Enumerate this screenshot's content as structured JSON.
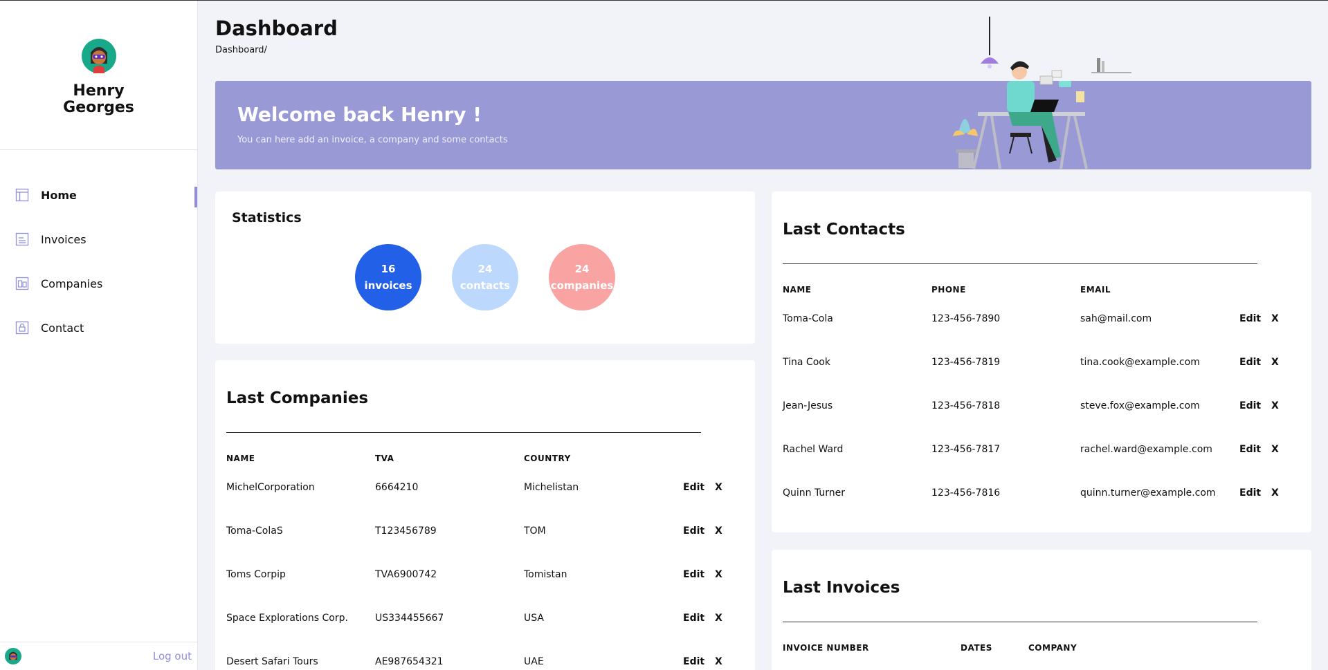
{
  "profile": {
    "name": "Henry Georges"
  },
  "nav": {
    "items": [
      {
        "label": "Home",
        "icon": "layout-icon",
        "active": true
      },
      {
        "label": "Invoices",
        "icon": "list-icon",
        "active": false
      },
      {
        "label": "Companies",
        "icon": "building-icon",
        "active": false
      },
      {
        "label": "Contact",
        "icon": "lock-icon",
        "active": false
      }
    ]
  },
  "footer": {
    "logout": "Log out"
  },
  "header": {
    "title": "Dashboard",
    "breadcrumb": "Dashboard/"
  },
  "banner": {
    "title": "Welcome back Henry !",
    "subtitle": "You can here add an invoice, a company and some contacts"
  },
  "stats": {
    "title": "Statistics",
    "items": [
      {
        "value": "16",
        "label": "invoices"
      },
      {
        "value": "24",
        "label": "contacts"
      },
      {
        "value": "24",
        "label": "companies"
      }
    ]
  },
  "companies": {
    "title": "Last Companies",
    "headers": [
      "NAME",
      "TVA",
      "COUNTRY"
    ],
    "rows": [
      {
        "name": "MichelCorporation",
        "tva": "6664210",
        "country": "Michelistan"
      },
      {
        "name": "Toma-ColaS",
        "tva": "T123456789",
        "country": "TOM"
      },
      {
        "name": "Toms Corpip",
        "tva": "TVA6900742",
        "country": "Tomistan"
      },
      {
        "name": "Space Explorations Corp.",
        "tva": "US334455667",
        "country": "USA"
      },
      {
        "name": "Desert Safari Tours",
        "tva": "AE987654321",
        "country": "UAE"
      }
    ]
  },
  "contacts": {
    "title": "Last Contacts",
    "headers": [
      "NAME",
      "PHONE",
      "EMAIL"
    ],
    "rows": [
      {
        "name": "Toma-Cola",
        "phone": "123-456-7890",
        "email": "sah@mail.com"
      },
      {
        "name": "Tina Cook",
        "phone": "123-456-7819",
        "email": "tina.cook@example.com"
      },
      {
        "name": "Jean-Jesus",
        "phone": "123-456-7818",
        "email": "steve.fox@example.com"
      },
      {
        "name": "Rachel Ward",
        "phone": "123-456-7817",
        "email": "rachel.ward@example.com"
      },
      {
        "name": "Quinn Turner",
        "phone": "123-456-7816",
        "email": "quinn.turner@example.com"
      }
    ]
  },
  "invoices": {
    "title": "Last Invoices",
    "headers": [
      "INVOICE NUMBER",
      "DATES",
      "COMPANY"
    ]
  },
  "actions": {
    "edit": "Edit",
    "delete": "X"
  },
  "colors": {
    "accent": "#8f8fdc",
    "banner": "#9999d6",
    "invoices_circle": "#2360e8",
    "contacts_circle": "#bcd8fc",
    "companies_circle": "#f9a3a3"
  }
}
